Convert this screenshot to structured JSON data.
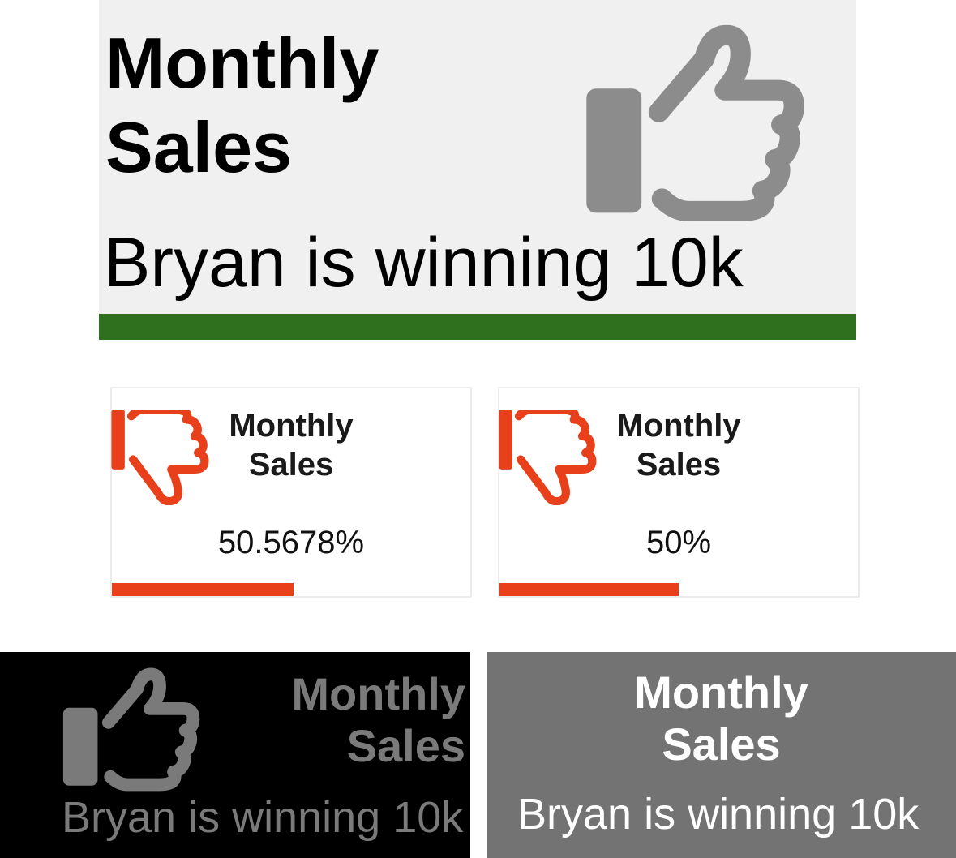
{
  "colors": {
    "card_main_bg": "#f0f0f0",
    "success_green": "#2e701e",
    "danger_orange": "#e8401a",
    "icon_gray": "#8c8c8c",
    "dark_bg": "#000000",
    "gray_bg": "#737373"
  },
  "cards": [
    {
      "title_line1": "Monthly",
      "title_line2": "Sales",
      "message": "Bryan is winning 10k",
      "icon": "thumbs-up-icon",
      "status": "success"
    },
    {
      "title_line1": "Monthly",
      "title_line2": "Sales",
      "value": "50.5678%",
      "progress": 0.505678,
      "icon": "thumbs-down-icon",
      "status": "danger"
    },
    {
      "title_line1": "Monthly",
      "title_line2": "Sales",
      "value": "50%",
      "progress": 0.5,
      "icon": "thumbs-down-icon",
      "status": "danger"
    },
    {
      "title_line1": "Monthly",
      "title_line2": "Sales",
      "message": "Bryan is winning 10k",
      "icon": "thumbs-up-icon",
      "theme": "dark"
    },
    {
      "title_line1": "Monthly",
      "title_line2": "Sales",
      "message": "Bryan is winning 10k",
      "theme": "gray"
    }
  ]
}
